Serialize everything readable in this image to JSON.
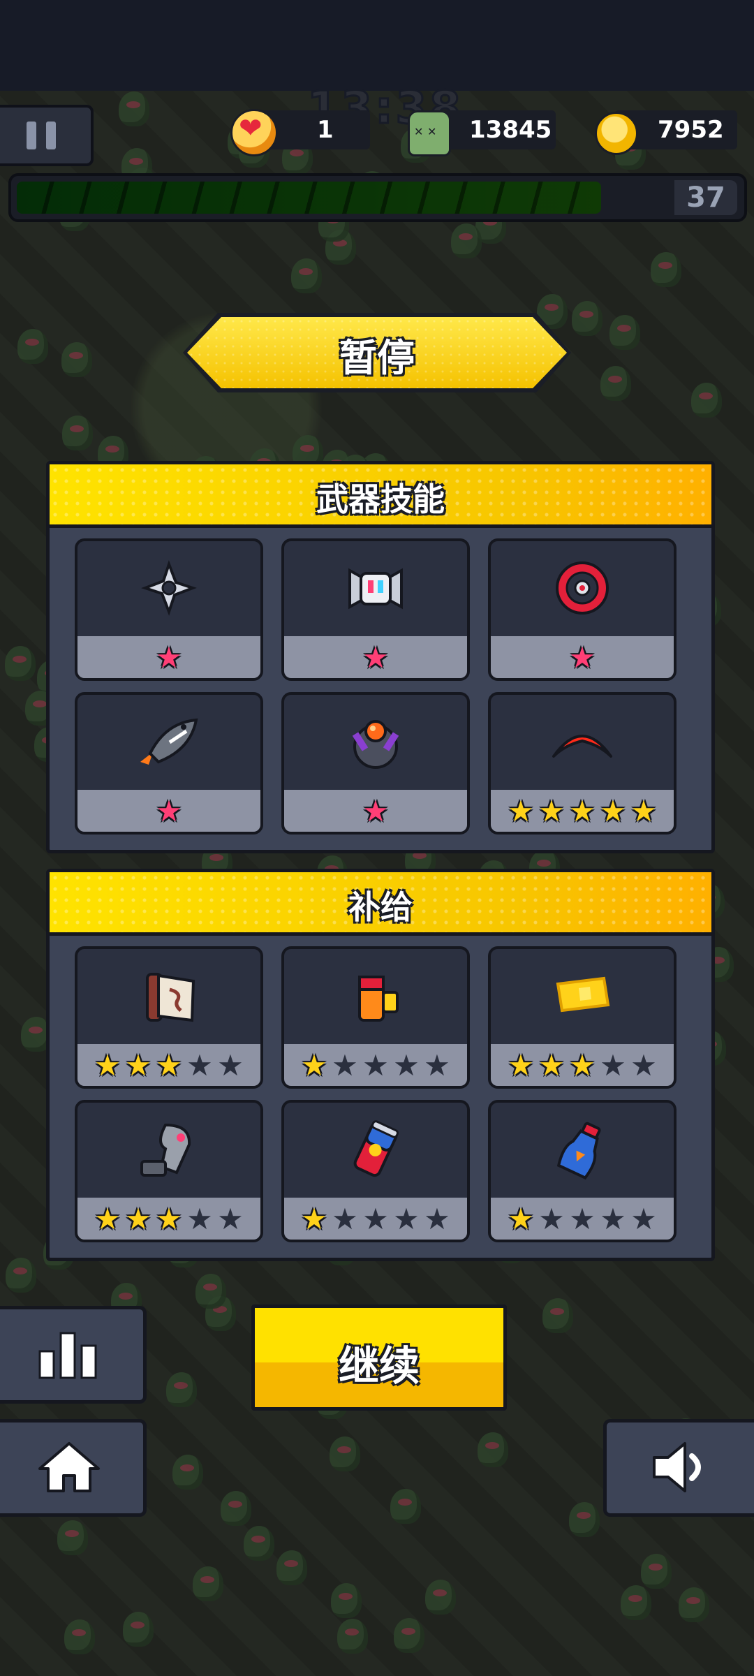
{
  "hud": {
    "timer": "13:38",
    "lives": "1",
    "kills": "13845",
    "coins": "7952",
    "level": "37",
    "xp_progress": 0.89
  },
  "pause_title": "暂停",
  "weapons": {
    "title": "武器技能",
    "items": [
      {
        "icon": "shuriken-icon",
        "stars": 1,
        "max": 1
      },
      {
        "icon": "drone-icon",
        "stars": 1,
        "max": 1
      },
      {
        "icon": "red-saw-icon",
        "stars": 1,
        "max": 1
      },
      {
        "icon": "shark-rocket-icon",
        "stars": 1,
        "max": 1
      },
      {
        "icon": "orb-turret-icon",
        "stars": 1,
        "max": 1
      },
      {
        "icon": "boomerang-icon",
        "stars": 5,
        "max": 5
      }
    ]
  },
  "supplies": {
    "title": "补给",
    "items": [
      {
        "icon": "scroll-icon",
        "stars": 3,
        "max": 5
      },
      {
        "icon": "battery-icon",
        "stars": 1,
        "max": 5
      },
      {
        "icon": "gold-ticket-icon",
        "stars": 3,
        "max": 5
      },
      {
        "icon": "armguard-icon",
        "stars": 3,
        "max": 5
      },
      {
        "icon": "energy-can-icon",
        "stars": 1,
        "max": 5
      },
      {
        "icon": "potion-icon",
        "stars": 1,
        "max": 5
      }
    ]
  },
  "buttons": {
    "continue": "继续"
  },
  "colors": {
    "accent_yellow": "#ffe100",
    "panel": "#3d4457",
    "star_on": "#ffd21a",
    "star_pink": "#ff3f76"
  }
}
